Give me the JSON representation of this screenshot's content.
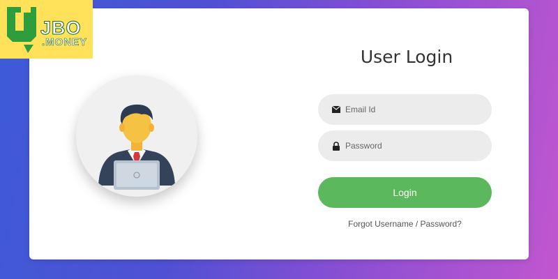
{
  "brand": {
    "name": "JBO",
    "sub": ".MONEY",
    "colors": {
      "background": "#ffe259",
      "mark": "#2e9e3c"
    }
  },
  "login": {
    "title": "User Login",
    "email_placeholder": "Email Id",
    "password_placeholder": "Password",
    "button_label": "Login",
    "forgot_link": "Forgot Username / Password?",
    "colors": {
      "button": "#5cb85c",
      "field_bg": "#ececec"
    }
  },
  "icons": {
    "email": "envelope-icon",
    "password": "lock-icon",
    "avatar": "user-avatar-icon"
  }
}
